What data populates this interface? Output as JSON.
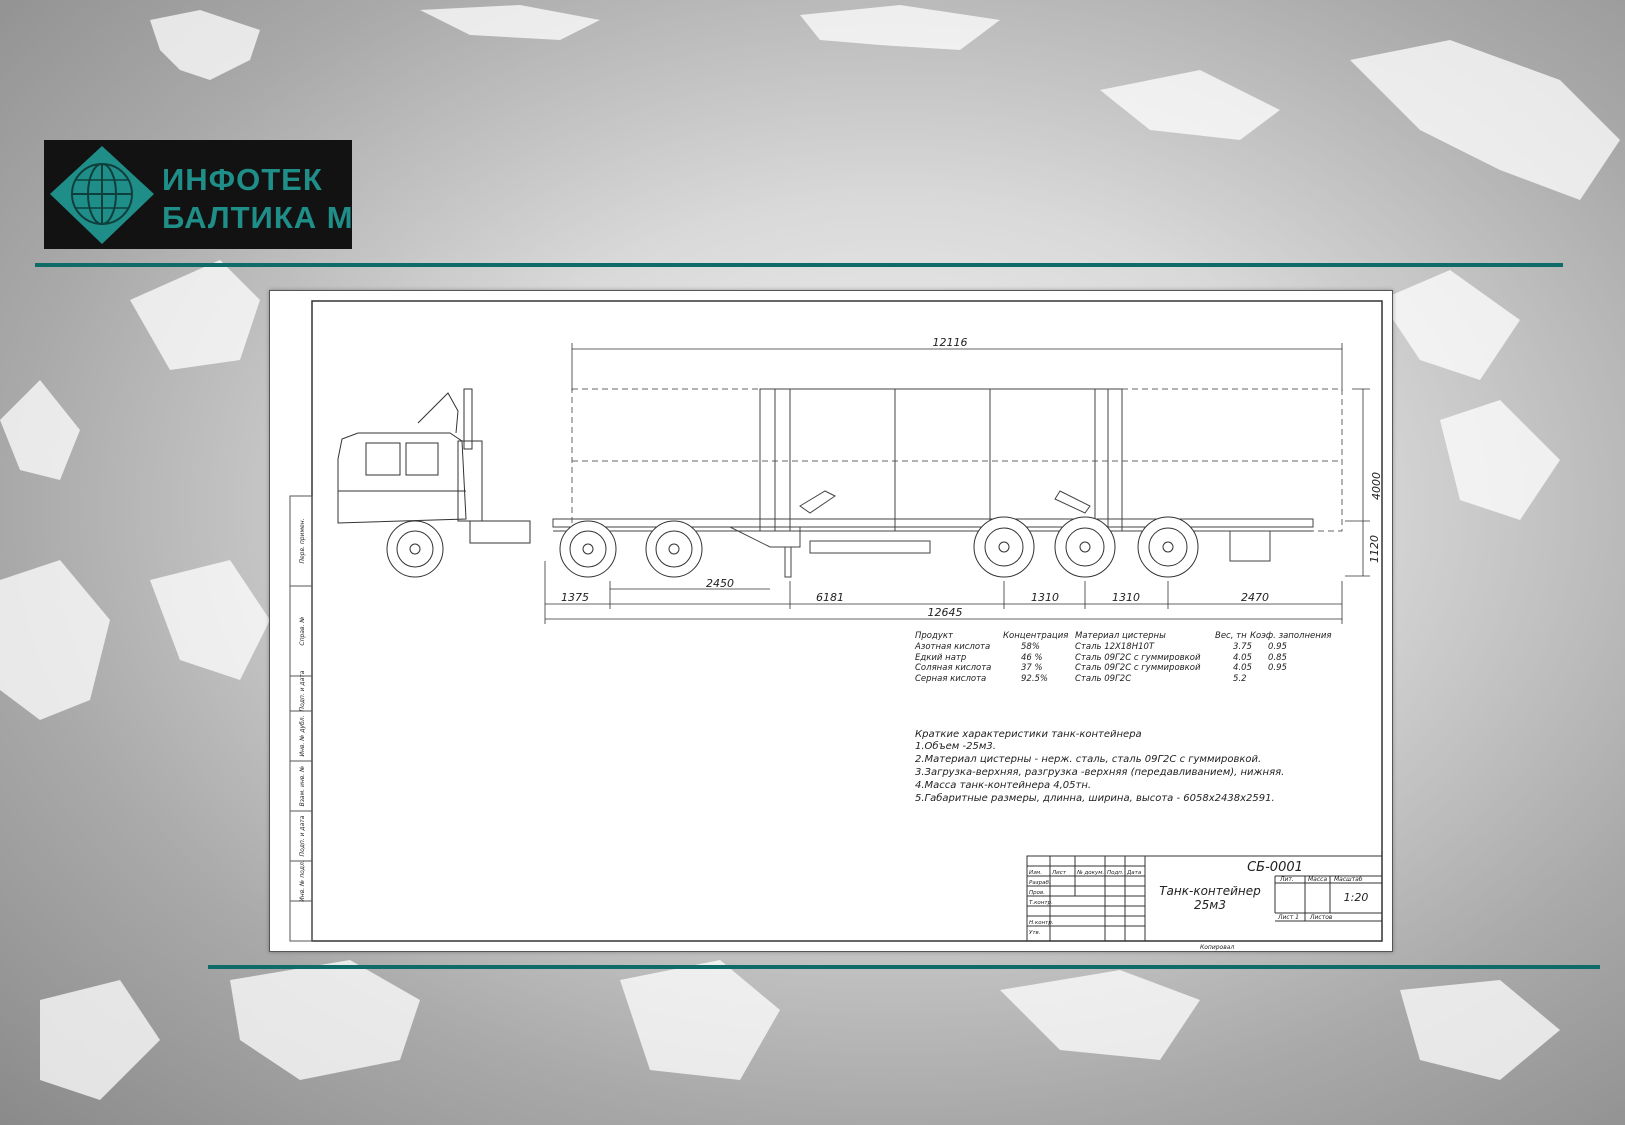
{
  "logo": {
    "line1": "ИНФОТЕК",
    "line2": "БАЛТИКА М"
  },
  "colors": {
    "accent": "#0e6b67",
    "logo_text": "#1f8e88",
    "logo_bg": "#121212"
  },
  "drawing": {
    "dimensions": {
      "overall": "12116",
      "height_total": "4000",
      "height_frame": "1120",
      "d1": "1375",
      "d2": "2450",
      "d3": "6181",
      "d4": "1310",
      "d5": "1310",
      "d6": "2470",
      "wheelbase": "12645"
    },
    "product_table": {
      "headers": [
        "Продукт",
        "Концентрация",
        "Материал цистерны",
        "Вес, тн",
        "Коэф. заполнения"
      ],
      "rows": [
        [
          "Азотная кислота",
          "58%",
          "Сталь 12Х18Н10Т",
          "3.75",
          "0.95"
        ],
        [
          "Едкий натр",
          "46 %",
          "Сталь 09Г2С с гуммировкой",
          "4.05",
          "0.85"
        ],
        [
          "Соляная кислота",
          "37 %",
          "Сталь 09Г2С с гуммировкой",
          "4.05",
          "0.95"
        ],
        [
          "Серная кислота",
          "92.5%",
          "Сталь 09Г2С",
          "5.2",
          ""
        ]
      ]
    },
    "notes": {
      "title": "Краткие характеристики танк-контейнера",
      "items": [
        "1.Объем -25м3.",
        "2.Материал цистерны - нерж. сталь, сталь 09Г2С с гуммировкой.",
        "3.Загрузка-верхняя, разгрузка -верхняя (передавливанием), нижняя.",
        "4.Масса танк-контейнера 4,05тн.",
        "5.Габаритные размеры, длинна, ширина, высота - 6058х2438х2591."
      ]
    },
    "title_block": {
      "code": "СБ-0001",
      "name_line1": "Танк-контейнер",
      "name_line2": "25м3",
      "scale": "1:20",
      "col_lit": "Лит.",
      "col_mass": "Масса",
      "col_scale": "Масштаб",
      "sheet": "Лист 1",
      "sheets": "Листов",
      "copied": "Копировал",
      "rows": [
        "Изм.",
        "Лист",
        "№ докум.",
        "Подп.",
        "Дата",
        "Разраб.",
        "Пров.",
        "Т.контр.",
        "Н.контр.",
        "Утв."
      ]
    },
    "side_stamp": [
      "Перв. примен.",
      "Справ. №",
      "Подп. и дата",
      "Инв. № дубл.",
      "Взам. инв. №",
      "Подп. и дата",
      "Инв. № подл."
    ]
  }
}
